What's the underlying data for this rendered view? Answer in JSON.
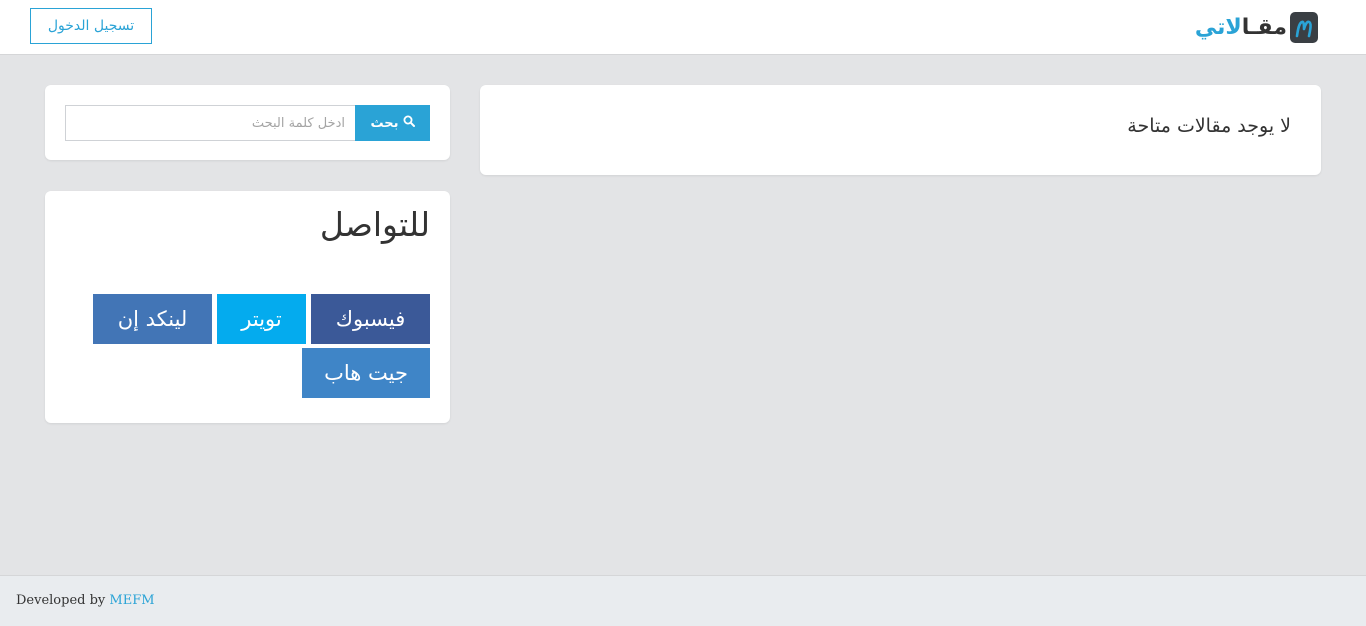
{
  "header": {
    "login_label": "تسجيل الدخول",
    "brand_part_accent": "لاتي",
    "brand_part_dark": "مقـا",
    "logo_icon": "logo-m-icon"
  },
  "articles": {
    "empty_message": "لا يوجد مقالات متاحة"
  },
  "search": {
    "placeholder": "ادخل كلمة البحث",
    "button_label": "بحث",
    "button_icon": "search-icon"
  },
  "contact": {
    "title": "للتواصل",
    "buttons": [
      {
        "label": "فيسبوك",
        "color": "#3b5998"
      },
      {
        "label": "تويتر",
        "color": "#04abee"
      },
      {
        "label": "لينكد إن",
        "color": "#4275b6"
      },
      {
        "label": "جيت هاب",
        "color": "#3f85c7"
      }
    ]
  },
  "footer": {
    "prefix": "Developed by",
    "link_label": "MEFM"
  },
  "colors": {
    "accent": "#2aa3d6",
    "background": "#e3e4e6",
    "card": "#ffffff",
    "footer": "#e9ecef"
  }
}
